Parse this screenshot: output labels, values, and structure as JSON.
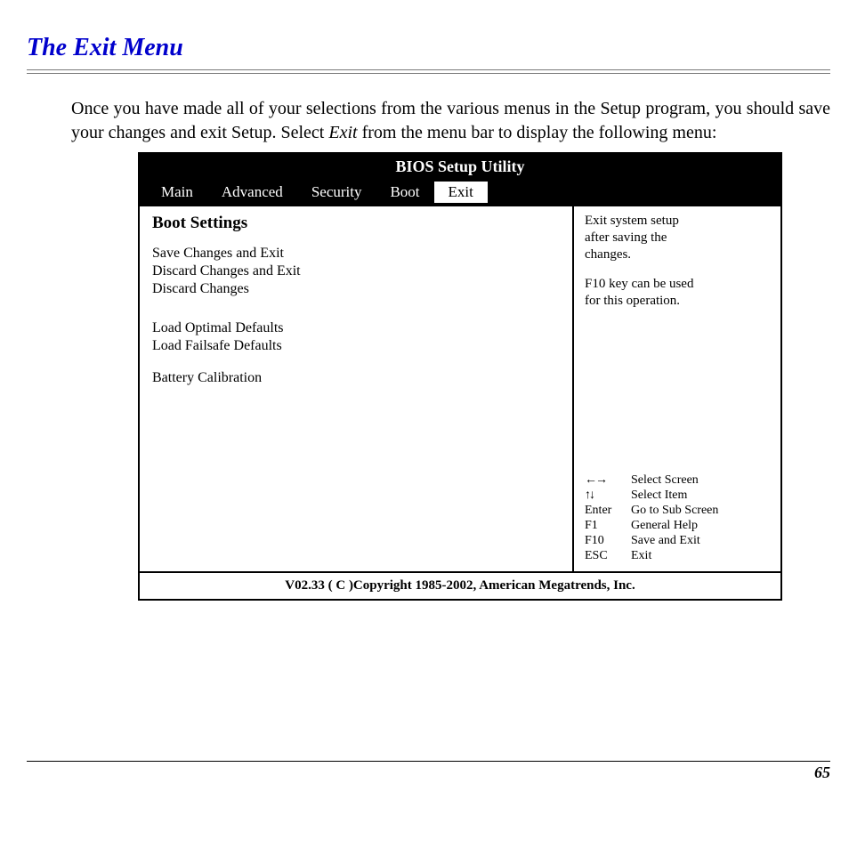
{
  "section_title": "The Exit Menu",
  "intro": {
    "pre": "Once you have made all of your selections from the various menus in the Setup program, you should save your changes and exit Setup.  Select ",
    "em": "Exit",
    "post": " from the menu bar to display the following menu:"
  },
  "bios": {
    "title": "BIOS Setup Utility",
    "tabs": [
      "Main",
      "Advanced",
      "Security",
      "Boot",
      "Exit"
    ],
    "selected_tab_index": 4,
    "panel_heading": "Boot Settings",
    "menu_group1": [
      "Save Changes and Exit",
      "Discard Changes and Exit",
      "Discard Changes"
    ],
    "menu_group2": [
      "Load Optimal Defaults",
      "Load Failsafe Defaults"
    ],
    "menu_group3": [
      "Battery Calibration"
    ],
    "help_block1": [
      "Exit system setup",
      "after saving the",
      "changes."
    ],
    "help_block2": [
      "F10 key can be used",
      "for this operation."
    ],
    "legend": [
      {
        "key_icon": "lr",
        "label": "Select Screen"
      },
      {
        "key_icon": "ud",
        "label": "Select Item"
      },
      {
        "key_text": "Enter",
        "label": "Go to Sub Screen"
      },
      {
        "key_text": "F1",
        "label": "General Help"
      },
      {
        "key_text": "F10",
        "label": "Save and Exit"
      },
      {
        "key_text": "ESC",
        "label": "Exit"
      }
    ],
    "footer": "V02.33 ( C )Copyright 1985-2002, American Megatrends, Inc."
  },
  "page_number": "65"
}
